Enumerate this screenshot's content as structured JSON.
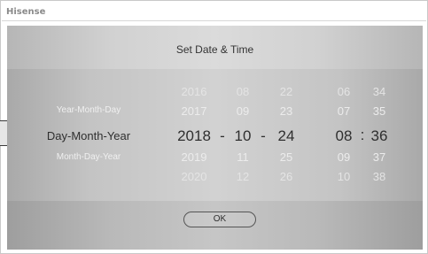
{
  "brand": "Hisense",
  "dialog": {
    "title": "Set Date & Time",
    "ok_label": "OK"
  },
  "date_formats": {
    "above": "Year-Month-Day",
    "selected": "Day-Month-Year",
    "below": "Month-Day-Year"
  },
  "picker": {
    "year": [
      "2016",
      "2017",
      "2018",
      "2019",
      "2020"
    ],
    "month": [
      "08",
      "09",
      "10",
      "11",
      "12"
    ],
    "day": [
      "22",
      "23",
      "24",
      "25",
      "26"
    ],
    "hour": [
      "06",
      "07",
      "08",
      "09",
      "10"
    ],
    "minute": [
      "34",
      "35",
      "36",
      "37",
      "38"
    ],
    "date_separator": "-",
    "time_separator": ":"
  },
  "colors": {
    "selected_text": "#2f2f2f",
    "unselected_text": "#e4e4e4"
  }
}
